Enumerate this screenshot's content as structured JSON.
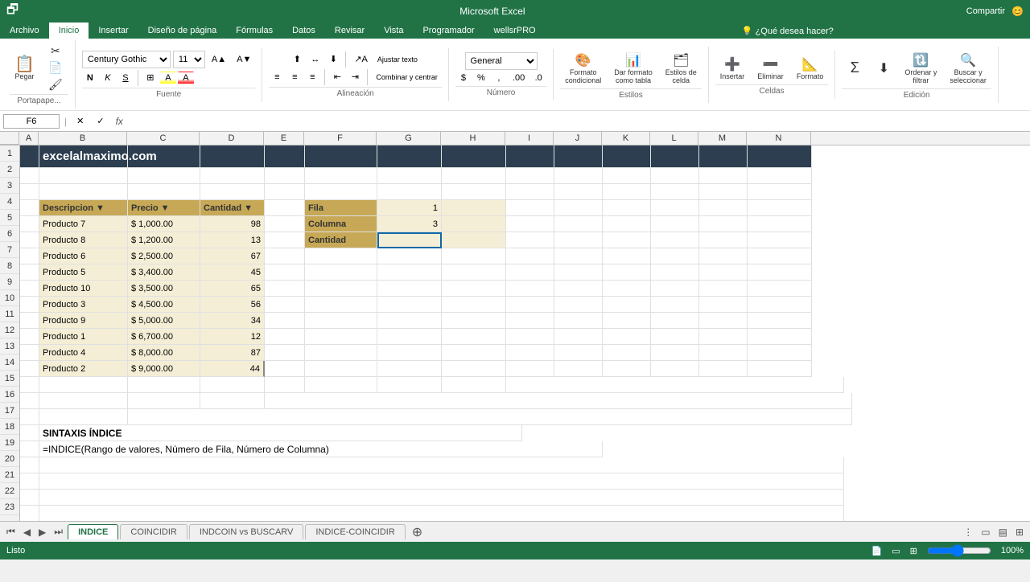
{
  "app": {
    "title": "Microsoft Excel",
    "file_name": "excelalmaximo.com"
  },
  "menu_tabs": [
    "Archivo",
    "Inicio",
    "Insertar",
    "Diseño de página",
    "Fórmulas",
    "Datos",
    "Revisar",
    "Vista",
    "Programador",
    "wellsrPRO"
  ],
  "active_tab": "Inicio",
  "cell_ref": "F6",
  "formula_content": "",
  "font": {
    "name": "Century Gothic",
    "size": "11"
  },
  "number_format": "General",
  "ribbon_groups": {
    "portapapeles": "Portapape...",
    "fuente": "Fuente",
    "alineacion": "Alineación",
    "numero": "Número",
    "estilos": "Estilos",
    "celdas": "Celdas",
    "edicion": "Edición"
  },
  "columns": [
    "A",
    "B",
    "C",
    "D",
    "E",
    "F",
    "G",
    "H",
    "I",
    "J",
    "K",
    "L",
    "M",
    "N"
  ],
  "rows": [
    1,
    2,
    3,
    4,
    5,
    6,
    7,
    8,
    9,
    10,
    11,
    12,
    13,
    14,
    15,
    16,
    17,
    18,
    19,
    20,
    21,
    22,
    23
  ],
  "grid_data": {
    "title": "excelalmaximo.com",
    "table_headers": [
      "Descripcion",
      "Precio",
      "Cantidad"
    ],
    "table_data": [
      [
        "Producto 7",
        "$  1,000.00",
        "98"
      ],
      [
        "Producto 8",
        "$  1,200.00",
        "13"
      ],
      [
        "Producto 6",
        "$  2,500.00",
        "67"
      ],
      [
        "Producto 5",
        "$  3,400.00",
        "45"
      ],
      [
        "Producto 10",
        "$  3,500.00",
        "65"
      ],
      [
        "Producto 3",
        "$  4,500.00",
        "56"
      ],
      [
        "Producto 9",
        "$  5,000.00",
        "34"
      ],
      [
        "Producto 1",
        "$  6,700.00",
        "12"
      ],
      [
        "Producto 4",
        "$  8,000.00",
        "87"
      ],
      [
        "Producto 2",
        "$  9,000.00",
        "44"
      ]
    ],
    "lookup_labels": [
      "Fila",
      "Columna",
      "Cantidad"
    ],
    "lookup_values": [
      "1",
      "3",
      ""
    ],
    "syntax_title": "SINTAXIS ÍNDICE",
    "syntax_formula": "=INDICE(Rango de valores, Número de Fila, Número de Columna)"
  },
  "sheet_tabs": [
    "INDICE",
    "COINCIDIR",
    "INDCOIN vs BUSCARV",
    "INDICE-COINCIDIR"
  ],
  "active_sheet": "INDICE",
  "status": {
    "left": "Listo",
    "icons": [
      "page-break",
      "layout-normal",
      "layout-page"
    ]
  },
  "toolbar": {
    "bold": "N",
    "italic": "K",
    "underline": "S",
    "border": "⊞",
    "fill": "A",
    "font_color": "A",
    "wrap_text": "Ajustar texto",
    "merge": "Combinar y centrar",
    "percent": "%",
    "comma": ",",
    "increase_decimal": ".0",
    "decrease_decimal": ".00",
    "paste": "Pegar",
    "format_conditional": "Formato\ncondicional",
    "format_table": "Dar formato\ncomo tabla",
    "cell_styles": "Estilos de\ncelda",
    "insert": "Insertar",
    "delete": "Eliminar",
    "format": "Formato",
    "sort_filter": "Ordenar y\nfiltrar",
    "find_select": "Buscar y\nseleccionar"
  }
}
